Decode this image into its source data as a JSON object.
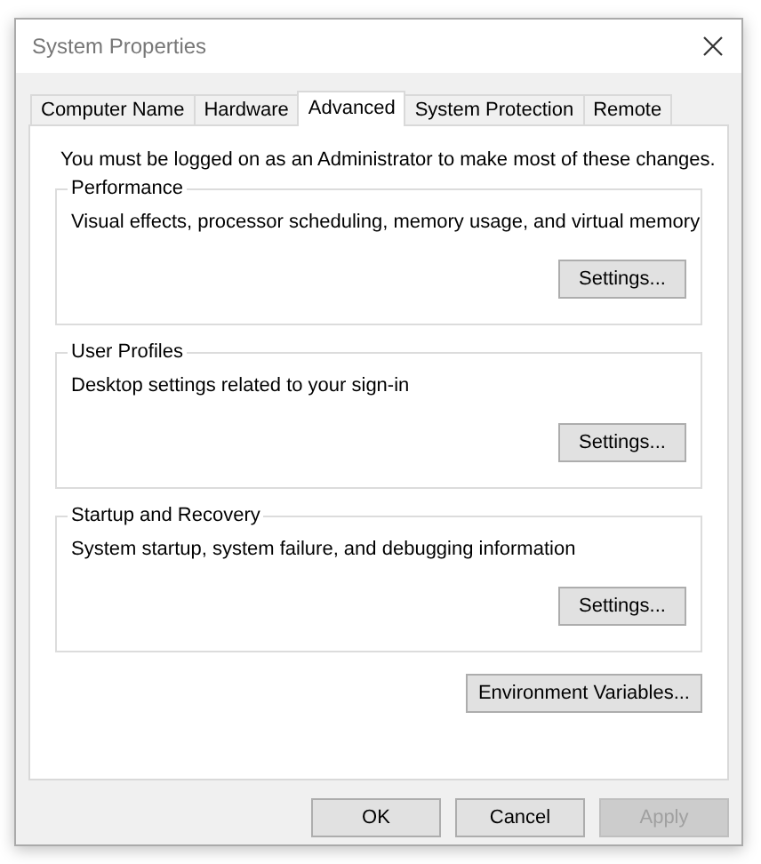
{
  "window": {
    "title": "System Properties"
  },
  "tabs": [
    {
      "label": "Computer Name",
      "selected": false
    },
    {
      "label": "Hardware",
      "selected": false
    },
    {
      "label": "Advanced",
      "selected": true
    },
    {
      "label": "System Protection",
      "selected": false
    },
    {
      "label": "Remote",
      "selected": false
    }
  ],
  "notice": "You must be logged on as an Administrator to make most of these changes.",
  "groups": [
    {
      "title": "Performance",
      "description": "Visual effects, processor scheduling, memory usage, and virtual memory",
      "button": "Settings..."
    },
    {
      "title": "User Profiles",
      "description": "Desktop settings related to your sign-in",
      "button": "Settings..."
    },
    {
      "title": "Startup and Recovery",
      "description": "System startup, system failure, and debugging information",
      "button": "Settings..."
    }
  ],
  "environment_button": "Environment Variables...",
  "buttons": [
    {
      "label": "OK",
      "disabled": false
    },
    {
      "label": "Cancel",
      "disabled": false
    },
    {
      "label": "Apply",
      "disabled": true
    }
  ]
}
